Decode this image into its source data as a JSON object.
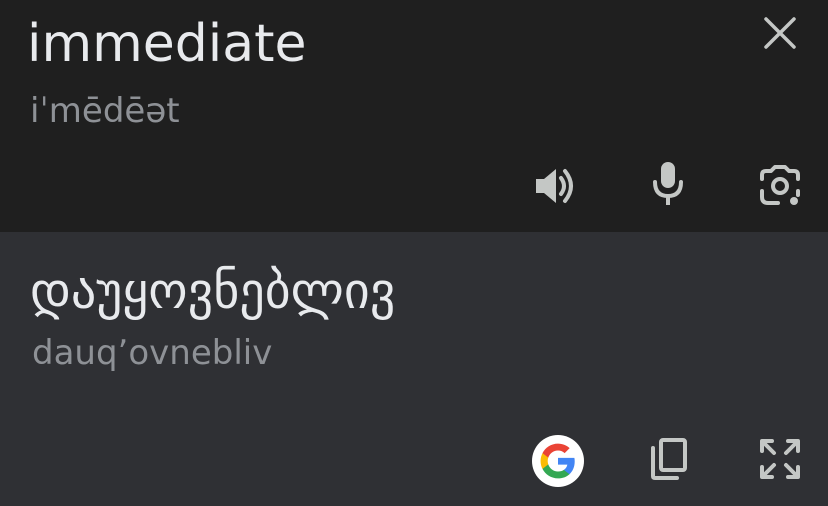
{
  "source": {
    "text": "immediate",
    "phonetic": "iˈmēdēət"
  },
  "target": {
    "text": "დაუყოვნებლივ",
    "transliteration": "dauq’ovnebliv"
  },
  "icons": {
    "close": "close-icon",
    "speaker": "speaker-icon",
    "mic": "microphone-icon",
    "camera": "camera-lens-icon",
    "google": "google-g-icon",
    "copy": "copy-icon",
    "fullscreen": "fullscreen-icon"
  },
  "colors": {
    "source_bg": "#1f1f1f",
    "target_bg": "#2f3034",
    "text_primary": "#e8eaed",
    "text_secondary": "#8e9196",
    "icon": "#c4c7c5"
  }
}
